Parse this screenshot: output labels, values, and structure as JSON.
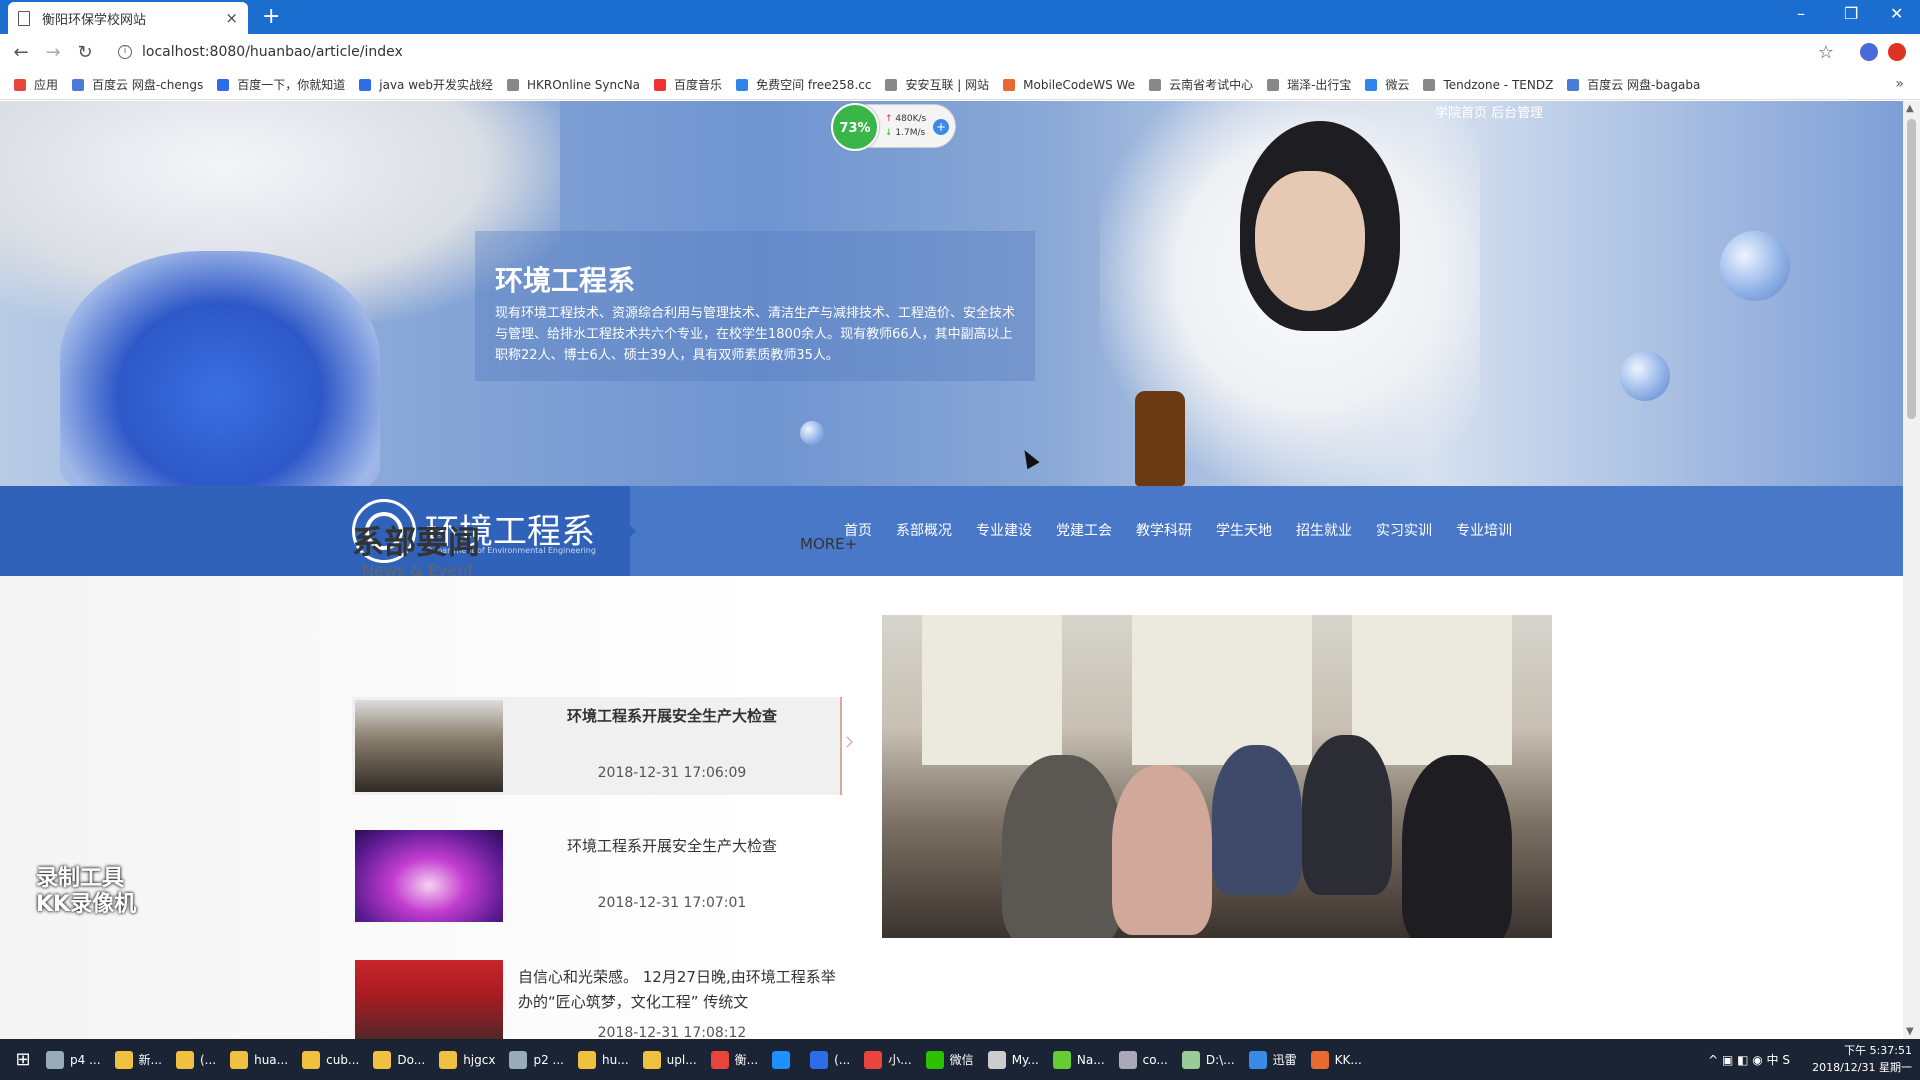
{
  "browser": {
    "tab_title": "衡阳环保学校网站",
    "tab_close": "×",
    "new_tab": "+",
    "url": "localhost:8080/huanbao/article/index",
    "window_controls": {
      "minimize": "–",
      "restore": "❐",
      "close": "✕"
    },
    "bookmarks": [
      {
        "label": "应用",
        "color": "#e8453c"
      },
      {
        "label": "百度云 网盘-chengs",
        "color": "#4a7bd6"
      },
      {
        "label": "百度一下，你就知道",
        "color": "#2f6de8"
      },
      {
        "label": "java web开发实战经",
        "color": "#2f6de8"
      },
      {
        "label": "HKROnline SyncNa",
        "color": "#888888"
      },
      {
        "label": "百度音乐",
        "color": "#e33"
      },
      {
        "label": "免费空间 free258.cc",
        "color": "#2f84e8"
      },
      {
        "label": "安安互联 | 网站",
        "color": "#888888"
      },
      {
        "label": "MobileCodeWS We",
        "color": "#e86a2f"
      },
      {
        "label": "云南省考试中心",
        "color": "#888888"
      },
      {
        "label": "瑞泽-出行宝",
        "color": "#888888"
      },
      {
        "label": "微云",
        "color": "#2f84e8"
      },
      {
        "label": "Tendzone - TENDZ",
        "color": "#888888"
      },
      {
        "label": "百度云 网盘-bagaba",
        "color": "#4a7bd6"
      }
    ],
    "bookmarks_more": "»"
  },
  "net_widget": {
    "percent": "73%",
    "up": "480K/s",
    "down": "1.7M/s",
    "plus": "+"
  },
  "site": {
    "top_links": "学院首页 后台管理",
    "hero": {
      "title": "环境工程系",
      "text": "现有环境工程技术、资源综合利用与管理技术、清洁生产与减排技术、工程造价、安全技术与管理、给排水工程技术共六个专业，在校学生1800余人。现有教师66人，其中副高以上职称22人、博士6人、硕士39人，具有双师素质教师35人。"
    },
    "logo": {
      "name": "环境工程系",
      "subtitle": "Department of Environmental Engineering"
    },
    "menu": [
      "首页",
      "系部概况",
      "专业建设",
      "党建工会",
      "教学科研",
      "学生天地",
      "招生就业",
      "实习实训",
      "专业培训"
    ],
    "news": {
      "title": "系部要闻",
      "subtitle": "News & Event",
      "more": "MORE+",
      "items": [
        {
          "title": "环境工程系开展安全生产大检查",
          "date": "2018-12-31 17:06:09"
        },
        {
          "title": "环境工程系开展安全生产大检查",
          "date": "2018-12-31 17:07:01"
        },
        {
          "title": "自信心和光荣感。 12月27日晚,由环境工程系举办的“匠心筑梦，文化工程” 传统文",
          "date": "2018-12-31 17:08:12"
        }
      ]
    }
  },
  "watermark": {
    "line1": "录制工具",
    "line2": "KK录像机"
  },
  "taskbar": {
    "start": "⊞",
    "items": [
      {
        "label": "p4 ...",
        "color": "#9ab"
      },
      {
        "label": "新...",
        "color": "#f0c040"
      },
      {
        "label": "(...",
        "color": "#f0c040"
      },
      {
        "label": "hua...",
        "color": "#f0c040"
      },
      {
        "label": "cub...",
        "color": "#f0c040"
      },
      {
        "label": "Do...",
        "color": "#f0c040"
      },
      {
        "label": "hjgcx",
        "color": "#f0c040"
      },
      {
        "label": "p2 ...",
        "color": "#9ab"
      },
      {
        "label": "hu...",
        "color": "#f0c040"
      },
      {
        "label": "upl...",
        "color": "#f0c040"
      },
      {
        "label": "衡...",
        "color": "#e8453c"
      },
      {
        "label": "",
        "color": "#1e90ff"
      },
      {
        "label": "(...",
        "color": "#2f6de8"
      },
      {
        "label": "小...",
        "color": "#e8453c"
      },
      {
        "label": "微信",
        "color": "#2dc100"
      },
      {
        "label": "My...",
        "color": "#ccc"
      },
      {
        "label": "Na...",
        "color": "#6c3"
      },
      {
        "label": "co...",
        "color": "#aab"
      },
      {
        "label": "D:\\...",
        "color": "#9c9"
      },
      {
        "label": "迅雷",
        "color": "#3b8be6"
      },
      {
        "label": "KK...",
        "color": "#e86a2f"
      }
    ],
    "tray_icons": "^ ▣ ◧ ◉ 中 S",
    "time": "下午 5:37:51",
    "date": "2018/12/31 星期一"
  }
}
